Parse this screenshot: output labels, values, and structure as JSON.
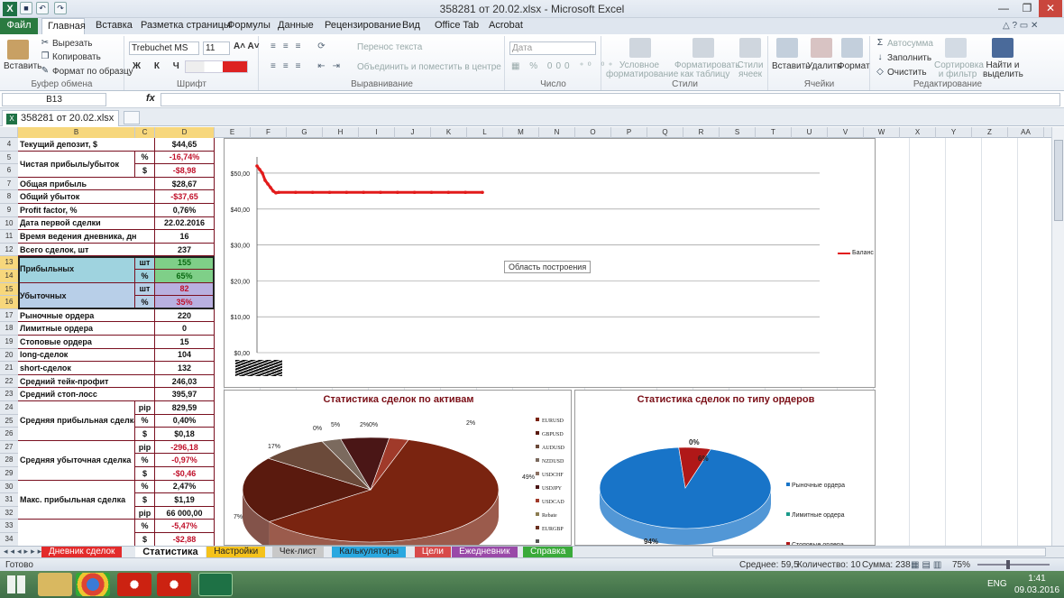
{
  "window": {
    "title": "358281 от 20.02.xlsx - Microsoft Excel"
  },
  "ribbon_tabs": [
    "Файл",
    "Главная",
    "Вставка",
    "Разметка страницы",
    "Формулы",
    "Данные",
    "Рецензирование",
    "Вид",
    "Office Tab",
    "Acrobat"
  ],
  "clipboard": {
    "paste": "Вставить",
    "cut": "Вырезать",
    "copy": "Копировать",
    "format_painter": "Формат по образцу",
    "group": "Буфер обмена"
  },
  "font": {
    "name": "Trebuchet MS",
    "size": "11",
    "group": "Шрифт"
  },
  "alignment": {
    "wrap": "Перенос текста",
    "merge": "Объединить и поместить в центре",
    "group": "Выравнивание"
  },
  "number": {
    "format": "Дата",
    "group": "Число"
  },
  "styles": {
    "conditional": "Условное форматирование",
    "table": "Форматировать как таблицу",
    "cell_styles": "Стили ячеек",
    "group": "Стили"
  },
  "cells": {
    "insert": "Вставить",
    "delete": "Удалить",
    "format": "Формат",
    "group": "Ячейки"
  },
  "editing": {
    "autosum": "Автосумма",
    "fill": "Заполнить",
    "clear": "Очистить",
    "sort": "Сортировка и фильтр",
    "find": "Найти и выделить",
    "group": "Редактирование"
  },
  "formula_bar": {
    "name_box": "B13",
    "fx": "fx",
    "value": ""
  },
  "doc_tab": "358281 от 20.02.xlsx *",
  "columns": [
    "B",
    "C",
    "D",
    "E",
    "F",
    "G",
    "H",
    "I",
    "J",
    "K",
    "L",
    "M",
    "N",
    "O",
    "P",
    "Q",
    "R",
    "S",
    "T",
    "U",
    "V",
    "W",
    "X",
    "Y",
    "Z",
    "AA"
  ],
  "rows": [
    {
      "n": "4",
      "label": "Текущий депозит, $",
      "unit": "",
      "value": "$44,65"
    },
    {
      "n": "5",
      "label": "Чистая прибыль/убыток",
      "unit": "%",
      "value": "-16,74%"
    },
    {
      "n": "6",
      "label": "",
      "unit": "$",
      "value": "-$8,98"
    },
    {
      "n": "7",
      "label": "Общая прибыль",
      "unit": "",
      "value": "$28,67"
    },
    {
      "n": "8",
      "label": "Общий убыток",
      "unit": "",
      "value": "-$37,65"
    },
    {
      "n": "9",
      "label": "Profit factor, %",
      "unit": "",
      "value": "0,76%"
    },
    {
      "n": "10",
      "label": "Дата первой сделки",
      "unit": "",
      "value": "22.02.2016"
    },
    {
      "n": "11",
      "label": "Время ведения дневника, дн",
      "unit": "",
      "value": "16"
    },
    {
      "n": "12",
      "label": "Всего сделок, шт",
      "unit": "",
      "value": "237"
    },
    {
      "n": "13",
      "label": "Прибыльных",
      "unit": "шт",
      "value": "155"
    },
    {
      "n": "14",
      "label": "",
      "unit": "%",
      "value": "65%"
    },
    {
      "n": "15",
      "label": "Убыточных",
      "unit": "шт",
      "value": "82"
    },
    {
      "n": "16",
      "label": "",
      "unit": "%",
      "value": "35%"
    },
    {
      "n": "17",
      "label": "Рыночные ордера",
      "unit": "",
      "value": "220"
    },
    {
      "n": "18",
      "label": "Лимитные ордера",
      "unit": "",
      "value": "0"
    },
    {
      "n": "19",
      "label": "Стоповые ордера",
      "unit": "",
      "value": "15"
    },
    {
      "n": "20",
      "label": "long-сделок",
      "unit": "",
      "value": "104"
    },
    {
      "n": "21",
      "label": "short-сделок",
      "unit": "",
      "value": "132"
    },
    {
      "n": "22",
      "label": "Средний тейк-профит",
      "unit": "",
      "value": "246,03"
    },
    {
      "n": "23",
      "label": "Средний стоп-лосс",
      "unit": "",
      "value": "395,97"
    },
    {
      "n": "24",
      "label": "",
      "unit": "pip",
      "value": "829,59"
    },
    {
      "n": "25",
      "label": "Средняя прибыльная сделка",
      "unit": "%",
      "value": "0,40%"
    },
    {
      "n": "26",
      "label": "",
      "unit": "$",
      "value": "$0,18"
    },
    {
      "n": "27",
      "label": "",
      "unit": "pip",
      "value": "-296,18"
    },
    {
      "n": "28",
      "label": "Средняя убыточная сделка",
      "unit": "%",
      "value": "-0,97%"
    },
    {
      "n": "29",
      "label": "",
      "unit": "$",
      "value": "-$0,46"
    },
    {
      "n": "30",
      "label": "",
      "unit": "%",
      "value": "2,47%"
    },
    {
      "n": "31",
      "label": "Макс. прибыльная сделка",
      "unit": "$",
      "value": "$1,19"
    },
    {
      "n": "32",
      "label": "",
      "unit": "pip",
      "value": "66 000,00"
    },
    {
      "n": "33",
      "label": "",
      "unit": "%",
      "value": "-5,47%"
    },
    {
      "n": "34",
      "label": "Макс. убыточная сделка",
      "unit": "$",
      "value": "-$2,88"
    }
  ],
  "chart_data": [
    {
      "type": "line",
      "title": "",
      "series": [
        {
          "name": "Баланс",
          "values": [
            52,
            51,
            50,
            48,
            47,
            46,
            45,
            44.5,
            44.65,
            44.65,
            44.65,
            44.65,
            44.65,
            44.65,
            44.65,
            44.65,
            44.65,
            44.65,
            44.65,
            44.65,
            44.65
          ]
        }
      ],
      "yticks": [
        "$0,00",
        "$10,00",
        "$20,00",
        "$30,00",
        "$40,00",
        "$50,00"
      ],
      "ylim": [
        0,
        52
      ],
      "tooltip": "Область построения",
      "legend": "right",
      "grid": true
    },
    {
      "type": "pie",
      "title": "Статистика сделок по активам",
      "categories": [
        "EURUSD",
        "GBPUSD",
        "AUDUSD",
        "NZDUSD",
        "USDCHF",
        "USDJPY",
        "USDCAD",
        "Rebate",
        "EURGBP",
        "",
        ""
      ],
      "labels": [
        "49%",
        "17%",
        "7%",
        "2%",
        "0%",
        "5%",
        "2%",
        "0%"
      ],
      "values": [
        49,
        17,
        7,
        2,
        0,
        5,
        2,
        0
      ],
      "legend": "right"
    },
    {
      "type": "pie",
      "title": "Статистика сделок по типу ордеров",
      "categories": [
        "Рыночные ордера",
        "Лимитные ордера",
        "Стоповые ордера"
      ],
      "values": [
        94,
        0,
        6
      ],
      "labels": [
        "94%",
        "0%",
        "6%"
      ],
      "colors": [
        "#1874c8",
        "#1a9a8a",
        "#b01818"
      ],
      "legend": "right"
    }
  ],
  "sheet_tabs": [
    "Дневник сделок",
    "Статистика",
    "Настройки",
    "Чек-лист",
    "Калькуляторы",
    "Цели",
    "Ежедневник",
    "Справка"
  ],
  "status": {
    "ready": "Готово",
    "avg": "Среднее: 59,5",
    "count": "Количество: 10",
    "sum": "Сумма: 238",
    "zoom": "75%"
  },
  "taskbar": {
    "lang": "ENG",
    "time": "1:41",
    "date": "09.03.2016"
  },
  "colors": {
    "excel_green": "#1e7145",
    "select_yellow": "#f7d77c",
    "border_red": "#7a1020"
  }
}
